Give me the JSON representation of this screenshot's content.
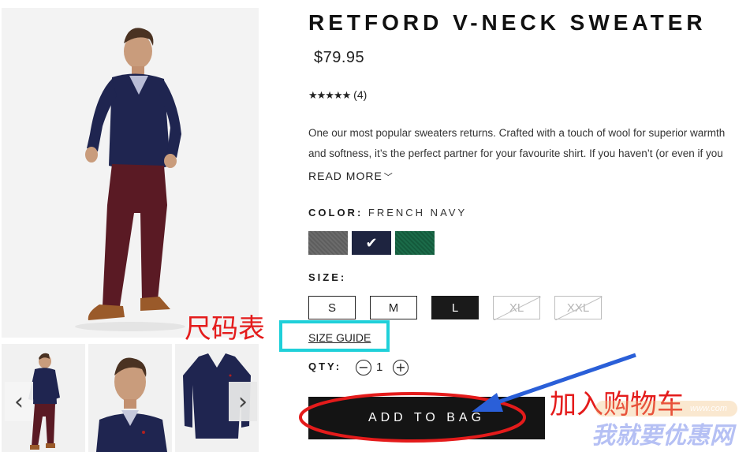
{
  "product": {
    "title": "RETFORD V-NECK SWEATER",
    "price": "$79.95",
    "stars": "★★★★★",
    "review_count": "(4)",
    "rating": 5,
    "description_line1": "One our most popular sweaters returns. Crafted with a touch of wool for superior warmth",
    "description_line2": "and softness, it’s the perfect partner for your favourite shirt. If you haven’t (or even if you",
    "read_more": "READ MORE"
  },
  "color": {
    "label": "COLOR:",
    "selected": "FRENCH NAVY",
    "swatches": [
      {
        "name": "grey",
        "hex": "#646464"
      },
      {
        "name": "french-navy",
        "hex": "#1e2440",
        "selected": true
      },
      {
        "name": "green",
        "hex": "#18613f"
      }
    ]
  },
  "size": {
    "label": "SIZE:",
    "options": [
      "S",
      "M",
      "L",
      "XL",
      "XXL"
    ],
    "selected": "L",
    "unavailable": [
      "XL",
      "XXL"
    ],
    "guide": "SIZE GUIDE"
  },
  "qty": {
    "label": "QTY:",
    "value": "1",
    "minus": "−",
    "plus": "+"
  },
  "actions": {
    "add_to_bag": "ADD TO BAG"
  },
  "gallery": {
    "prev_icon": "‹",
    "next_icon": "›"
  },
  "annotations": {
    "size_chart": "尺码表",
    "add_to_cart": "加入购物车",
    "annotation_color": "#e41b1b",
    "highlight_color": "#1fd0d9",
    "arrow_color": "#2a5fd8"
  },
  "watermark": {
    "text": "我就要优惠网",
    "small": "www.com"
  }
}
